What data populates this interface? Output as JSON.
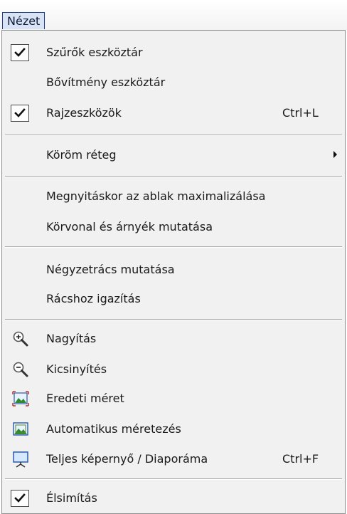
{
  "menubar": {
    "title": "Nézet"
  },
  "menu": {
    "items": [
      {
        "label": "Szűrők eszköztár",
        "checked": true,
        "shortcut": ""
      },
      {
        "label": "Bővítmény eszköztár",
        "checked": false,
        "shortcut": ""
      },
      {
        "label": "Rajzeszközök",
        "checked": true,
        "shortcut": "Ctrl+L"
      },
      {
        "label": "Köröm réteg",
        "submenu": true
      },
      {
        "label": "Megnyitáskor az ablak maximalizálása"
      },
      {
        "label": "Körvonal és árnyék mutatása"
      },
      {
        "label": "Négyzetrács mutatása"
      },
      {
        "label": "Rácshoz igazítás"
      },
      {
        "label": "Nagyítás",
        "icon": "zoom-in-icon"
      },
      {
        "label": "Kicsinyítés",
        "icon": "zoom-out-icon"
      },
      {
        "label": "Eredeti méret",
        "icon": "original-size-icon"
      },
      {
        "label": "Automatikus méretezés",
        "icon": "auto-resize-icon"
      },
      {
        "label": "Teljes képernyő / Diaporáma",
        "icon": "fullscreen-icon",
        "shortcut": "Ctrl+F"
      },
      {
        "label": "Élsimítás",
        "checked": true
      }
    ]
  },
  "colors": {
    "menu_title_bg": "#d8e4f5",
    "menu_title_border": "#1e3f8c",
    "menu_bg": "#f1f1f1",
    "separator": "#a7a7a7",
    "icon_green": "#2f8a2f",
    "icon_blue": "#2a5aa8"
  }
}
